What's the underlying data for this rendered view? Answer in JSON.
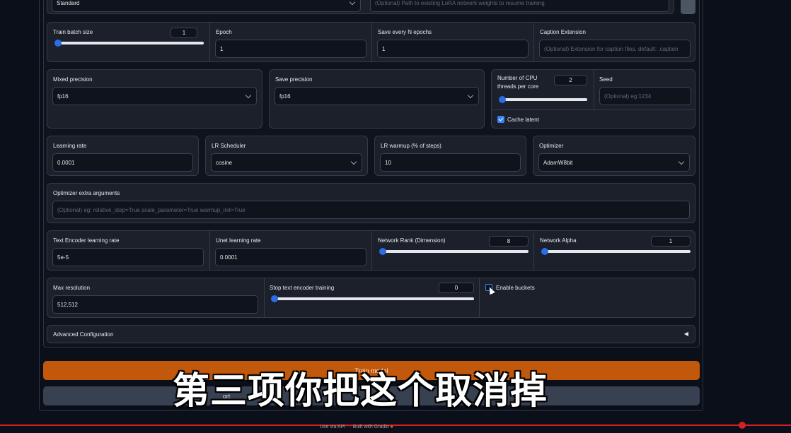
{
  "top_row": {
    "lora_type_value": "Standard",
    "lora_weights_placeholder": "(Optional) Path to existing LoRA network weights to resume training"
  },
  "row1": {
    "train_batch_label": "Train batch size",
    "train_batch_value": "1",
    "train_batch_level": 0,
    "epoch_label": "Epoch",
    "epoch_value": "1",
    "save_every_label": "Save every N epochs",
    "save_every_value": "1",
    "caption_ext_label": "Caption Extension",
    "caption_ext_placeholder": "(Optional) Extension for caption files. default: .caption"
  },
  "row2": {
    "mixed_precision_label": "Mixed precision",
    "mixed_precision_value": "fp16",
    "save_precision_label": "Save precision",
    "save_precision_value": "fp16",
    "cpu_threads_label": "Number of CPU threads per core",
    "cpu_threads_value": "2",
    "cpu_threads_level": 0,
    "seed_label": "Seed",
    "seed_placeholder": "(Optional) eg:1234",
    "cache_latent_label": "Cache latent",
    "cache_latent_checked": true
  },
  "row3": {
    "learning_rate_label": "Learning rate",
    "learning_rate_value": "0.0001",
    "lr_scheduler_label": "LR Scheduler",
    "lr_scheduler_value": "cosine",
    "lr_warmup_label": "LR warmup (% of steps)",
    "lr_warmup_value": "10",
    "optimizer_label": "Optimizer",
    "optimizer_value": "AdamW8bit"
  },
  "row4": {
    "opt_args_label": "Optimizer extra arguments",
    "opt_args_placeholder": "(Optional) eg: relative_step=True scale_parameter=True warmup_init=True"
  },
  "row5": {
    "te_lr_label": "Text Encoder learning rate",
    "te_lr_value": "5e-5",
    "unet_lr_label": "Unet learning rate",
    "unet_lr_value": "0.0001",
    "net_rank_label": "Network Rank (Dimension)",
    "net_rank_value": "8",
    "net_rank_level": 0,
    "net_alpha_label": "Network Alpha",
    "net_alpha_value": "1",
    "net_alpha_level": 0
  },
  "row6": {
    "max_res_label": "Max resolution",
    "max_res_value": "512,512",
    "stop_te_label": "Stop text encoder training",
    "stop_te_value": "0",
    "stop_te_level": 0,
    "enable_buckets_label": "Enable buckets",
    "enable_buckets_checked": false
  },
  "advanced": {
    "label": "Advanced Configuration",
    "arrow": "◀"
  },
  "buttons": {
    "train_label": "Train model",
    "grey_label": "ort"
  },
  "subtitle": "第三项你把这个取消掉",
  "footer": {
    "api_text": "Use via API",
    "built_text": "Built with Gradio"
  },
  "colors": {
    "accent_blue": "#2b6de6",
    "train_button": "#c2580c",
    "panel_bg": "#1b202b"
  }
}
